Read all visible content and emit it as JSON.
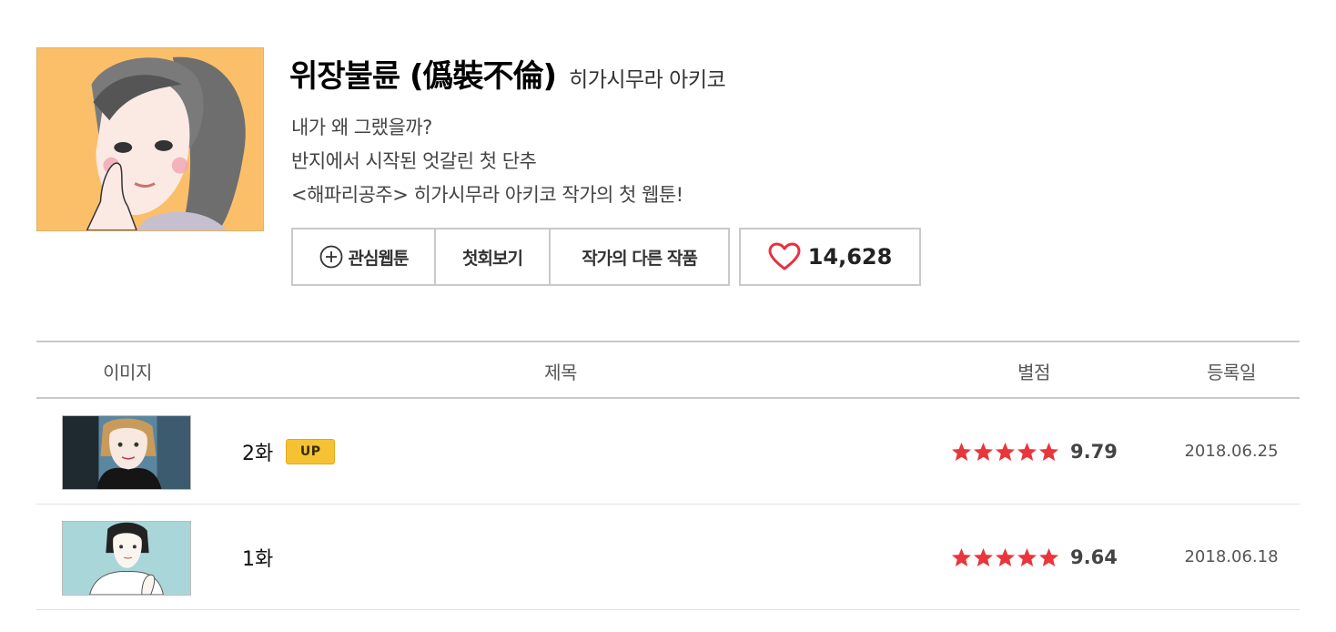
{
  "comic": {
    "title": "위장불륜 (僞裝不倫)",
    "author": "히가시무라 아키코",
    "synopsis": [
      "내가 왜 그랬을까?",
      "반지에서 시작된 엇갈린 첫 단추",
      "<해파리공주> 히가시무라 아키코 작가의 첫 웹툰!"
    ],
    "thumbnail_bg": "#fbbf6a"
  },
  "actions": {
    "favorite_label": "관심웹툰",
    "first_episode_label": "첫회보기",
    "other_works_label": "작가의 다른 작품",
    "like_count": "14,628",
    "heart_color": "#e8313e",
    "favorite_icon": "plus-circle-icon"
  },
  "table": {
    "headers": {
      "image": "이미지",
      "title": "제목",
      "rating": "별점",
      "date": "등록일"
    },
    "rows": [
      {
        "title": "2화",
        "badge": "UP",
        "rating": "9.79",
        "stars": 5,
        "date": "2018.06.25"
      },
      {
        "title": "1화",
        "badge": "",
        "rating": "9.64",
        "stars": 5,
        "date": "2018.06.18"
      }
    ]
  },
  "colors": {
    "star": "#e8363b",
    "badge": "#f5c233",
    "border": "#c9c9c9"
  }
}
